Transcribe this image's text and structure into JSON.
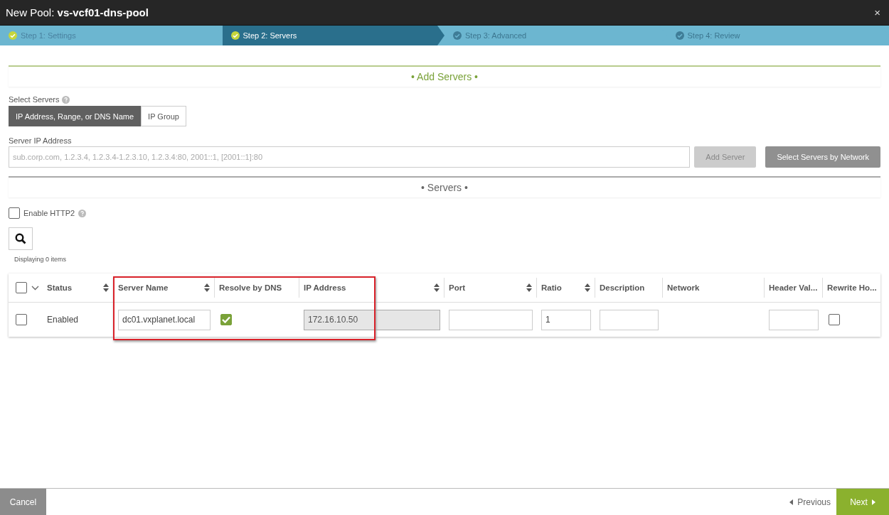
{
  "window": {
    "title": "New Pool: **vs-vcf01-dns-pool**",
    "close": "×"
  },
  "steps": [
    {
      "label": "Step 1: Settings",
      "selected": false,
      "done": true
    },
    {
      "label": "Step 2: Servers",
      "selected": true,
      "done": true
    },
    {
      "label": "Step 3: Advanced",
      "selected": false,
      "done": false
    },
    {
      "label": "Step 4: Review",
      "selected": false,
      "done": false
    }
  ],
  "add_section": {
    "title": "• Add Servers •",
    "select_label": "Select Servers",
    "options": [
      {
        "label": "IP Address, Range, or DNS Name",
        "selected": true
      },
      {
        "label": "IP Group",
        "selected": false
      }
    ],
    "field_label": "Server IP Address",
    "placeholder": "sub.corp.com, 1.2.3.4, 1.2.3.4-1.2.3.10, 1.2.3.4:80, 2001::1, [2001::1]:80",
    "add_button": {
      "label": "Add Server",
      "disabled": true
    },
    "network_button": "Select Servers by Network"
  },
  "servers_section": {
    "title": "• Servers •",
    "http2": {
      "label": "Enable HTTP2",
      "checked": false
    },
    "count": "Displaying 0 items"
  },
  "table": {
    "select_all": {
      "checked": false
    },
    "columns": [
      {
        "label": "Status",
        "sortable": true
      },
      {
        "label": "Server Name",
        "sortable": true
      },
      {
        "label": "Resolve by DNS",
        "sortable": false
      },
      {
        "label": "IP Address",
        "sortable": true
      },
      {
        "label": "Port",
        "sortable": true
      },
      {
        "label": "Ratio",
        "sortable": true
      },
      {
        "label": "Description",
        "sortable": false
      },
      {
        "label": "Network",
        "sortable": false
      },
      {
        "label": "Header Val...",
        "sortable": false
      },
      {
        "label": "Rewrite Ho...",
        "sortable": false
      }
    ],
    "rows": [
      {
        "selected": false,
        "cells": [
          {
            "kind": "text",
            "value": "Enabled"
          },
          {
            "kind": "input",
            "value": "dc01.vxplanet.local"
          },
          {
            "kind": "checkbox",
            "checked": true
          },
          {
            "kind": "readonly",
            "value": "172.16.10.50"
          },
          {
            "kind": "input"
          },
          {
            "kind": "input",
            "value": "1"
          },
          {
            "kind": "input"
          },
          {
            "kind": "empty"
          },
          {
            "kind": "input"
          },
          {
            "kind": "checkbox",
            "checked": false
          }
        ]
      }
    ]
  },
  "footer": {
    "cancel": "Cancel",
    "previous": "Previous",
    "next": "Next"
  }
}
